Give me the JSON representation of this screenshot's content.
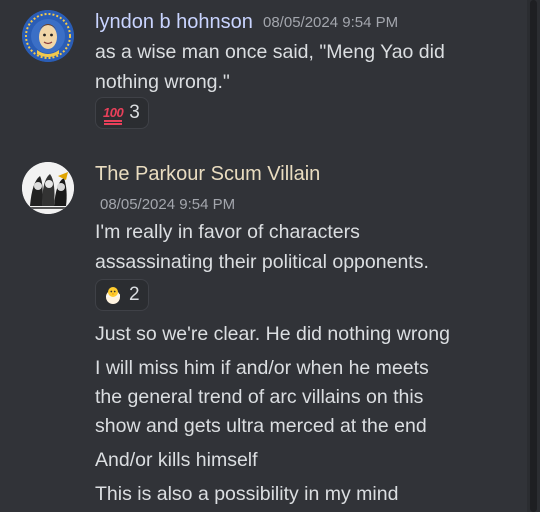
{
  "messages": [
    {
      "author": "lyndon b hohnson",
      "author_color": "#c9d4ff",
      "timestamp": "08/05/2024 9:54 PM",
      "lines": [
        "as a wise man once said, \"Meng Yao did",
        "nothing wrong.\""
      ],
      "reaction": {
        "emoji": "hundred-points-icon",
        "count": "3"
      }
    },
    {
      "author": "The Parkour Scum Villain",
      "author_color": "#e9dcc0",
      "timestamp": "08/05/2024 9:54 PM",
      "lines": [
        "I'm really in favor of characters",
        "assassinating their political opponents."
      ],
      "reaction": {
        "emoji": "hatching-chick-icon",
        "count": "2"
      },
      "followups": [
        [
          "Just so we're clear. He did nothing wrong"
        ],
        [
          "I will miss him if and/or when he meets",
          "the general trend of arc villains on this",
          "show and gets ultra merced at the end"
        ],
        [
          "And/or kills himself"
        ],
        [
          "This is also a possibility in my mind"
        ]
      ]
    }
  ]
}
